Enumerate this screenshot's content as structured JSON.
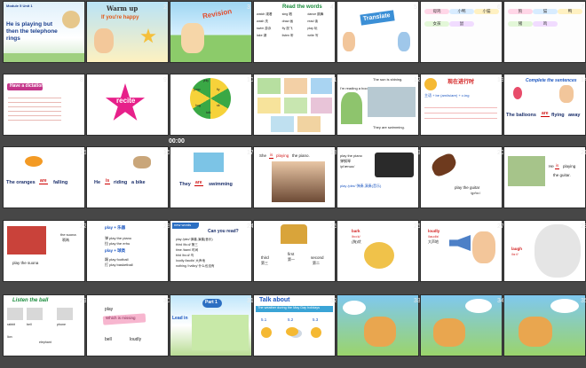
{
  "slides": [
    {
      "number": "1",
      "title": "He is playing but then the telephone rings",
      "module": "Module 5  Unit 1"
    },
    {
      "number": "2",
      "title": "Warm up",
      "subtitle": "If you're happy"
    },
    {
      "number": "3",
      "title": "Revision"
    },
    {
      "number": "4",
      "title": "Read the words",
      "words": [
        "watch 观看",
        "sing 唱",
        "dance 跳舞",
        "wash 洗",
        "draw 画",
        "read 读",
        "swim 游泳",
        "fly 放飞",
        "play 玩",
        "lake 湖",
        "listen 听",
        "write 写"
      ]
    },
    {
      "number": "5",
      "title": "Translate"
    },
    {
      "number": "6",
      "words": [
        "母鸡",
        "小鸭",
        "小猫",
        "女孩",
        "鼠"
      ]
    },
    {
      "number": "7",
      "words": [
        "狗",
        "猫",
        "鸭",
        "猪",
        "鸡"
      ]
    },
    {
      "number": "8",
      "title": "Have a dictation"
    },
    {
      "number": "9",
      "title": "recite"
    },
    {
      "number": "10",
      "words": [
        "jump",
        "jelly",
        "fly",
        "sit",
        "talk",
        "hug"
      ],
      "time": "00:00"
    },
    {
      "number": "11"
    },
    {
      "number": "12",
      "caption1": "The sun is shining.",
      "caption2": "I'm reading a book.",
      "caption3": "They are swimming."
    },
    {
      "number": "13",
      "title": "现在进行时",
      "formula": "主语 + be (am/is/are) + v-ing"
    },
    {
      "number": "14",
      "title": "Complete the sentences",
      "sentence_start": "The balloons",
      "blank": "are",
      "sentence_mid": "flying",
      "sentence_end": "away"
    },
    {
      "number": "15",
      "sentence_start": "The oranges",
      "blank": "are",
      "sentence_end": "falling"
    },
    {
      "number": "16",
      "sentence_start": "He",
      "blank": "is",
      "sentence_mid": "riding",
      "sentence_end": "a bike"
    },
    {
      "number": "17",
      "sentence_start": "They",
      "blank": "are",
      "sentence_end": "swimming"
    },
    {
      "number": "18",
      "sentence_start": "She",
      "blank": "is",
      "sentence_mid": "playing",
      "sentence_end": "the piano."
    },
    {
      "number": "19",
      "text1": "play the piano",
      "text2": "弹钢琴",
      "text3": "/pi'ænəu/",
      "text4": "play /pleɪ/   弹奏,演奏(音乐)"
    },
    {
      "number": "20",
      "text1": "play the guitar",
      "text2": "/gɪ'tɑː/"
    },
    {
      "number": "21",
      "sentence_start": "He",
      "blank": "is",
      "sentence_mid": "playing",
      "sentence_end": "the guitar."
    },
    {
      "number": "22",
      "text1": "the suona",
      "text2": "唢呐",
      "text3": "play  the suona"
    },
    {
      "number": "23",
      "text1": "play + 乐器",
      "lines": [
        "弹 play the piano",
        "拉 play the erhu",
        "play + 球类",
        "踢 play football",
        "打 play basketball"
      ]
    },
    {
      "number": "24",
      "title": "Can you read?",
      "tab": "new words",
      "lines": [
        "play /pleɪ/ 弹奏,演奏(音乐)",
        "third /θɜːd/ 第三",
        "time /taɪm/ 时间",
        "bird /bɜːd/ 鸟",
        "loudly /laudlɪ/ 大声地",
        "nothing /'nʌθɪŋ/ 什么也没有"
      ]
    },
    {
      "number": "25",
      "text1": "third",
      "text2": "第三",
      "text3": "first",
      "text4": "第一",
      "text5": "second",
      "text6": "第二"
    },
    {
      "number": "26",
      "text1": "bark",
      "text2": "/bɑːk/",
      "text3": "(狗)吠"
    },
    {
      "number": "27",
      "text1": "loudly",
      "text2": "/laudlɪ/",
      "text3": "大声地"
    },
    {
      "number": "28",
      "text1": "laugh",
      "text2": "/lɑːf/"
    },
    {
      "number": "29",
      "title": "Listen the ball",
      "words": [
        "rabbit",
        "lion",
        "bell",
        "elephant",
        "phone"
      ]
    },
    {
      "number": "30",
      "words": [
        "play",
        "Which is missing",
        "bell",
        "loudly"
      ]
    },
    {
      "number": "31",
      "title": "Part 1",
      "subtitle": "Lead in"
    },
    {
      "number": "32",
      "title": "Talk about",
      "subtitle": "The weather during the May Day holidays",
      "dates": [
        "5.1",
        "5.2",
        "5.3"
      ]
    },
    {
      "number": "33"
    },
    {
      "number": "34"
    },
    {
      "number": "35"
    }
  ]
}
